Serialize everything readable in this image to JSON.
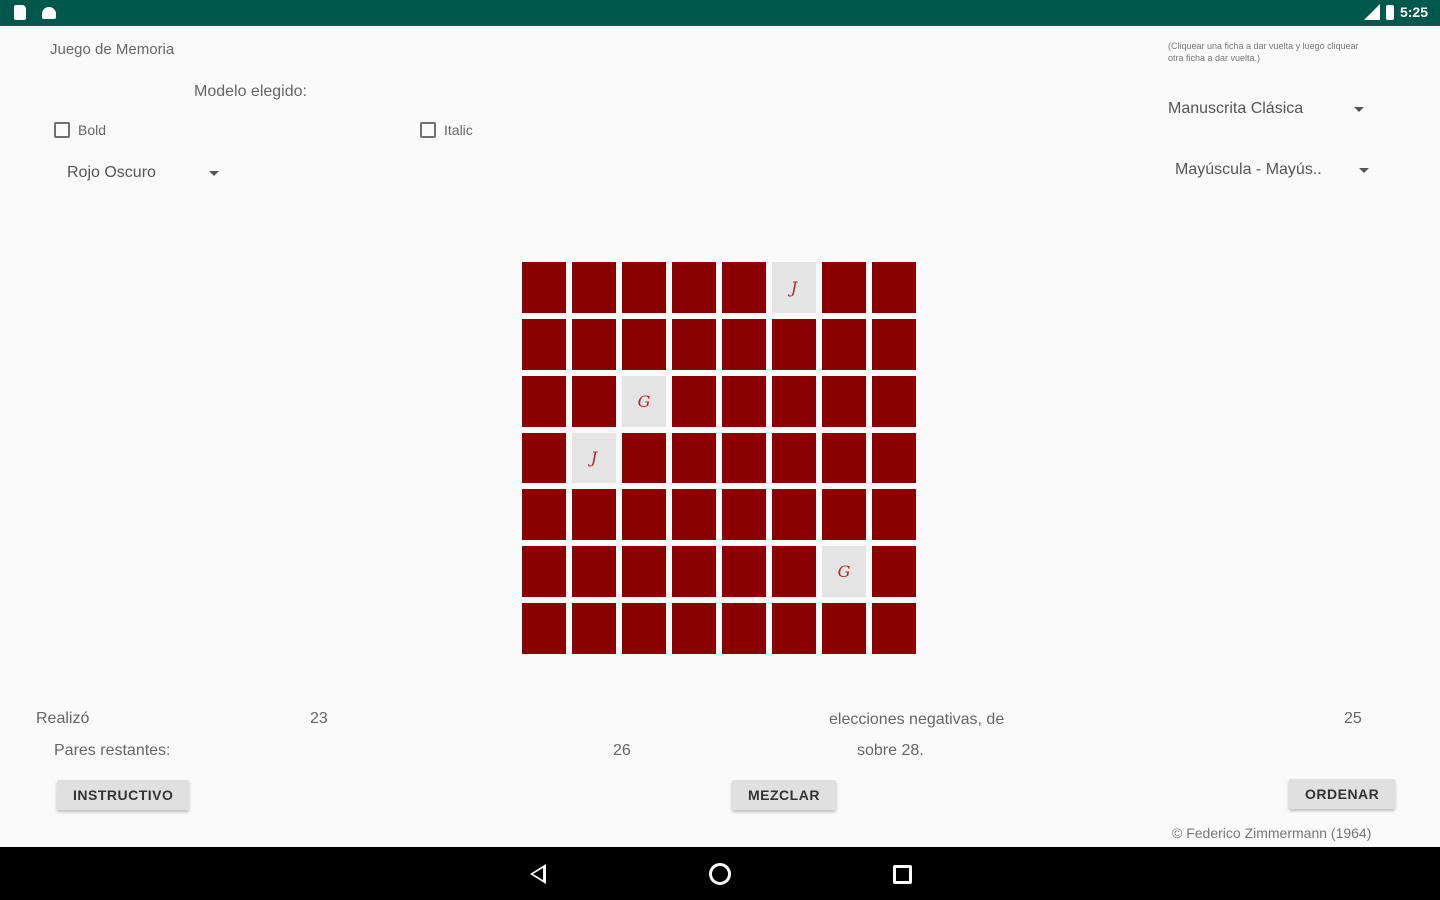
{
  "status_bar": {
    "time": "5:25",
    "icons_left": [
      "sd-card-icon",
      "android-icon"
    ],
    "icons_right": [
      "signal-icon",
      "battery-icon"
    ]
  },
  "header": {
    "app_title": "Juego de Memoria",
    "instructions_hint": "(Cliquear una ficha a dar vuelta y luego cliquear otra ficha a dar vuelta.)",
    "model_label": "Modelo elegido:"
  },
  "options": {
    "bold_label": "Bold",
    "bold_checked": false,
    "italic_label": "Italic",
    "italic_checked": false,
    "color_select": "Rojo Oscuro",
    "font_select": "Manuscrita Clásica",
    "case_select": "Mayúscula - Mayús.."
  },
  "board": {
    "columns": 8,
    "rows": 7,
    "hidden_color": "#8b0000",
    "revealed_color": "#e4e4e4",
    "revealed_tiles": [
      {
        "row": 0,
        "col": 5,
        "letter": "J"
      },
      {
        "row": 2,
        "col": 2,
        "letter": "G"
      },
      {
        "row": 3,
        "col": 1,
        "letter": "J"
      },
      {
        "row": 5,
        "col": 6,
        "letter": "G"
      }
    ]
  },
  "stats": {
    "made_label": "Realizó",
    "made_value": "23",
    "negative_label": "elecciones negativas, de",
    "negative_value": "25",
    "remaining_label": "Pares restantes:",
    "remaining_value": "26",
    "total_label": "sobre 28."
  },
  "buttons": {
    "instructions": "INSTRUCTIVO",
    "shuffle": "MEZCLAR",
    "sort": "ORDENAR"
  },
  "footer": {
    "copyright": "© Federico Zimmermann (1964)"
  },
  "nav": {
    "back_icon": "back-icon",
    "home_icon": "home-icon",
    "recents_icon": "recents-icon"
  }
}
